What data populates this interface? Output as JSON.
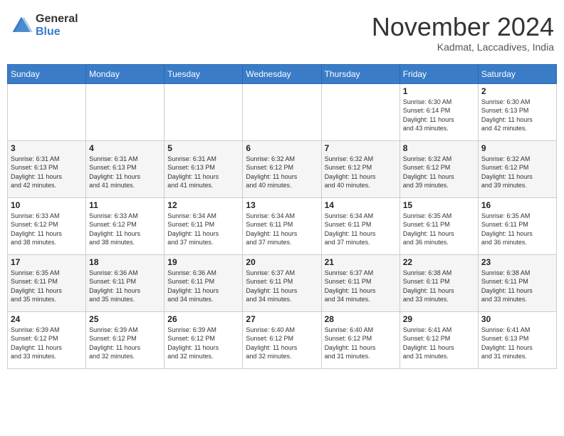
{
  "header": {
    "logo_general": "General",
    "logo_blue": "Blue",
    "month_title": "November 2024",
    "location": "Kadmat, Laccadives, India"
  },
  "calendar": {
    "days_of_week": [
      "Sunday",
      "Monday",
      "Tuesday",
      "Wednesday",
      "Thursday",
      "Friday",
      "Saturday"
    ],
    "weeks": [
      [
        {
          "day": "",
          "info": ""
        },
        {
          "day": "",
          "info": ""
        },
        {
          "day": "",
          "info": ""
        },
        {
          "day": "",
          "info": ""
        },
        {
          "day": "",
          "info": ""
        },
        {
          "day": "1",
          "info": "Sunrise: 6:30 AM\nSunset: 6:14 PM\nDaylight: 11 hours\nand 43 minutes."
        },
        {
          "day": "2",
          "info": "Sunrise: 6:30 AM\nSunset: 6:13 PM\nDaylight: 11 hours\nand 42 minutes."
        }
      ],
      [
        {
          "day": "3",
          "info": "Sunrise: 6:31 AM\nSunset: 6:13 PM\nDaylight: 11 hours\nand 42 minutes."
        },
        {
          "day": "4",
          "info": "Sunrise: 6:31 AM\nSunset: 6:13 PM\nDaylight: 11 hours\nand 41 minutes."
        },
        {
          "day": "5",
          "info": "Sunrise: 6:31 AM\nSunset: 6:13 PM\nDaylight: 11 hours\nand 41 minutes."
        },
        {
          "day": "6",
          "info": "Sunrise: 6:32 AM\nSunset: 6:12 PM\nDaylight: 11 hours\nand 40 minutes."
        },
        {
          "day": "7",
          "info": "Sunrise: 6:32 AM\nSunset: 6:12 PM\nDaylight: 11 hours\nand 40 minutes."
        },
        {
          "day": "8",
          "info": "Sunrise: 6:32 AM\nSunset: 6:12 PM\nDaylight: 11 hours\nand 39 minutes."
        },
        {
          "day": "9",
          "info": "Sunrise: 6:32 AM\nSunset: 6:12 PM\nDaylight: 11 hours\nand 39 minutes."
        }
      ],
      [
        {
          "day": "10",
          "info": "Sunrise: 6:33 AM\nSunset: 6:12 PM\nDaylight: 11 hours\nand 38 minutes."
        },
        {
          "day": "11",
          "info": "Sunrise: 6:33 AM\nSunset: 6:12 PM\nDaylight: 11 hours\nand 38 minutes."
        },
        {
          "day": "12",
          "info": "Sunrise: 6:34 AM\nSunset: 6:11 PM\nDaylight: 11 hours\nand 37 minutes."
        },
        {
          "day": "13",
          "info": "Sunrise: 6:34 AM\nSunset: 6:11 PM\nDaylight: 11 hours\nand 37 minutes."
        },
        {
          "day": "14",
          "info": "Sunrise: 6:34 AM\nSunset: 6:11 PM\nDaylight: 11 hours\nand 37 minutes."
        },
        {
          "day": "15",
          "info": "Sunrise: 6:35 AM\nSunset: 6:11 PM\nDaylight: 11 hours\nand 36 minutes."
        },
        {
          "day": "16",
          "info": "Sunrise: 6:35 AM\nSunset: 6:11 PM\nDaylight: 11 hours\nand 36 minutes."
        }
      ],
      [
        {
          "day": "17",
          "info": "Sunrise: 6:35 AM\nSunset: 6:11 PM\nDaylight: 11 hours\nand 35 minutes."
        },
        {
          "day": "18",
          "info": "Sunrise: 6:36 AM\nSunset: 6:11 PM\nDaylight: 11 hours\nand 35 minutes."
        },
        {
          "day": "19",
          "info": "Sunrise: 6:36 AM\nSunset: 6:11 PM\nDaylight: 11 hours\nand 34 minutes."
        },
        {
          "day": "20",
          "info": "Sunrise: 6:37 AM\nSunset: 6:11 PM\nDaylight: 11 hours\nand 34 minutes."
        },
        {
          "day": "21",
          "info": "Sunrise: 6:37 AM\nSunset: 6:11 PM\nDaylight: 11 hours\nand 34 minutes."
        },
        {
          "day": "22",
          "info": "Sunrise: 6:38 AM\nSunset: 6:11 PM\nDaylight: 11 hours\nand 33 minutes."
        },
        {
          "day": "23",
          "info": "Sunrise: 6:38 AM\nSunset: 6:11 PM\nDaylight: 11 hours\nand 33 minutes."
        }
      ],
      [
        {
          "day": "24",
          "info": "Sunrise: 6:39 AM\nSunset: 6:12 PM\nDaylight: 11 hours\nand 33 minutes."
        },
        {
          "day": "25",
          "info": "Sunrise: 6:39 AM\nSunset: 6:12 PM\nDaylight: 11 hours\nand 32 minutes."
        },
        {
          "day": "26",
          "info": "Sunrise: 6:39 AM\nSunset: 6:12 PM\nDaylight: 11 hours\nand 32 minutes."
        },
        {
          "day": "27",
          "info": "Sunrise: 6:40 AM\nSunset: 6:12 PM\nDaylight: 11 hours\nand 32 minutes."
        },
        {
          "day": "28",
          "info": "Sunrise: 6:40 AM\nSunset: 6:12 PM\nDaylight: 11 hours\nand 31 minutes."
        },
        {
          "day": "29",
          "info": "Sunrise: 6:41 AM\nSunset: 6:12 PM\nDaylight: 11 hours\nand 31 minutes."
        },
        {
          "day": "30",
          "info": "Sunrise: 6:41 AM\nSunset: 6:13 PM\nDaylight: 11 hours\nand 31 minutes."
        }
      ]
    ]
  }
}
